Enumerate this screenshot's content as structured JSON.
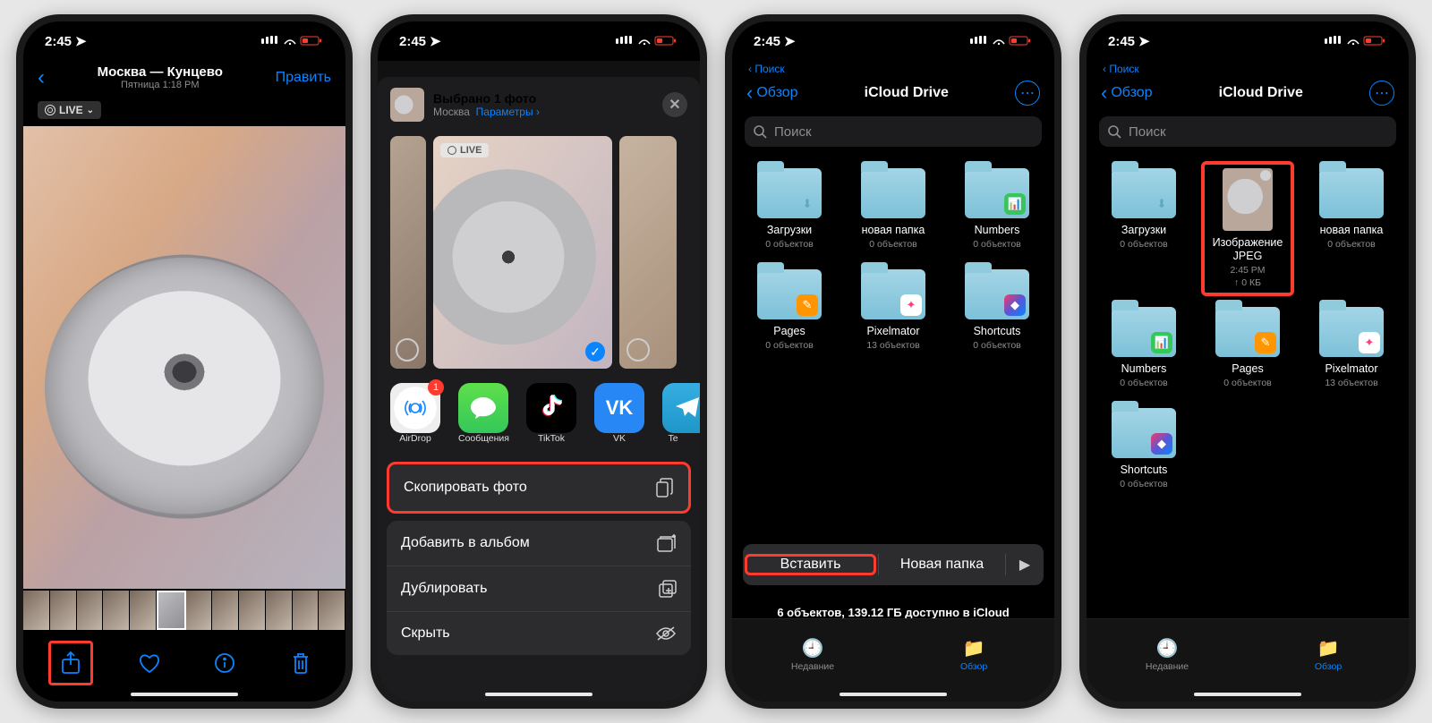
{
  "status": {
    "time": "2:45",
    "loc_arrow": "↗"
  },
  "phone1": {
    "title": "Москва — Кунцево",
    "subtitle": "Пятница 1:18 PM",
    "edit": "Править",
    "live": "LIVE"
  },
  "phone2": {
    "header_title": "Выбрано 1 фото",
    "header_loc": "Москва",
    "header_params": "Параметры",
    "apps": {
      "airdrop": "AirDrop",
      "messages": "Сообщения",
      "tiktok": "TikTok",
      "vk": "VK",
      "telegram": "Te",
      "airdrop_badge": "1"
    },
    "actions": {
      "copy": "Скопировать фото",
      "add_album": "Добавить в альбом",
      "duplicate": "Дублировать",
      "hide": "Скрыть"
    },
    "live": "LIVE"
  },
  "files": {
    "search_back": "Поиск",
    "browse": "Обзор",
    "title": "iCloud Drive",
    "search_placeholder": "Поиск",
    "tabs": {
      "recent": "Недавние",
      "browse": "Обзор"
    }
  },
  "phone3": {
    "downloads": {
      "name": "Загрузки",
      "meta": "0 объектов"
    },
    "newfolder": {
      "name": "новая папка",
      "meta": "0 объектов"
    },
    "numbers": {
      "name": "Numbers",
      "meta": "0 объектов"
    },
    "pages": {
      "name": "Pages",
      "meta": "0 объектов"
    },
    "pixelmator": {
      "name": "Pixelmator",
      "meta": "13 объектов"
    },
    "shortcuts": {
      "name": "Shortcuts",
      "meta": "0 объектов"
    },
    "ctx": {
      "paste": "Вставить",
      "newfolder": "Новая папка"
    },
    "storage": "6 объектов, 139.12 ГБ доступно в iCloud"
  },
  "phone4": {
    "downloads": {
      "name": "Загрузки",
      "meta": "0 объектов"
    },
    "image_jpeg": {
      "name": "Изображение JPEG",
      "meta1": "2:45 PM",
      "meta2": "↑ 0 КБ"
    },
    "newfolder": {
      "name": "новая папка",
      "meta": "0 объектов"
    },
    "numbers": {
      "name": "Numbers",
      "meta": "0 объектов"
    },
    "pages": {
      "name": "Pages",
      "meta": "0 объектов"
    },
    "pixelmator": {
      "name": "Pixelmator",
      "meta": "13 объектов"
    },
    "shortcuts": {
      "name": "Shortcuts",
      "meta": "0 объектов"
    }
  }
}
